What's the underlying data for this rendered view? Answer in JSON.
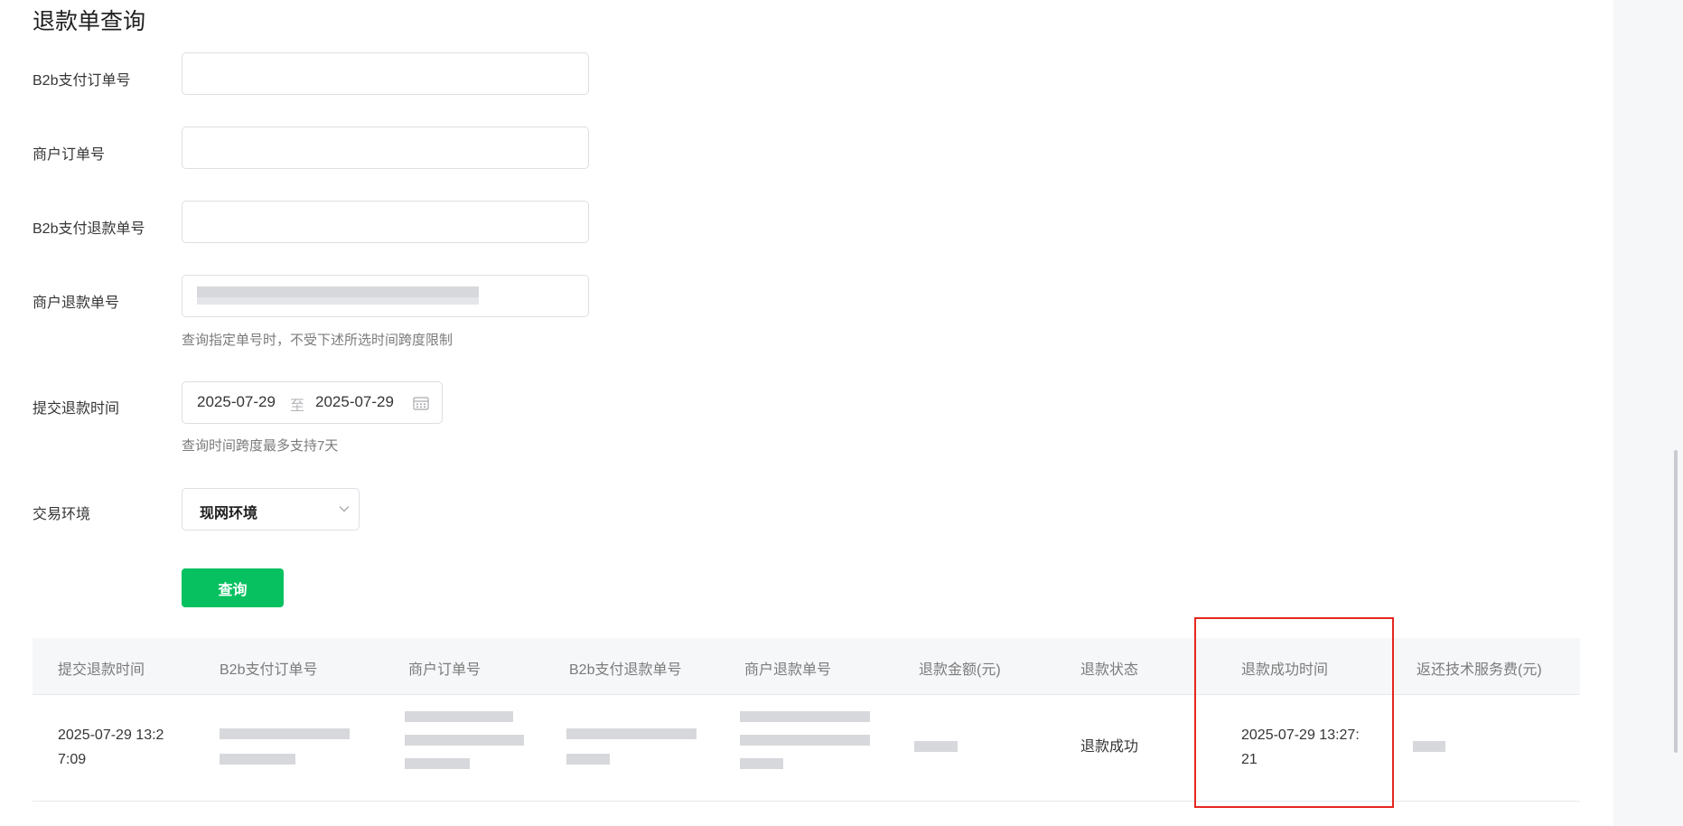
{
  "page": {
    "title": "退款单查询"
  },
  "form": {
    "b2b_order_label": "B2b支付订单号",
    "b2b_order_value": "",
    "merchant_order_label": "商户订单号",
    "merchant_order_value": "",
    "b2b_refund_label": "B2b支付退款单号",
    "b2b_refund_value": "",
    "merchant_refund_label": "商户退款单号",
    "merchant_refund_hint": "查询指定单号时，不受下述所选时间跨度限制",
    "refund_time_label": "提交退款时间",
    "date_start": "2025-07-29",
    "date_separator": "至",
    "date_end": "2025-07-29",
    "date_hint": "查询时间跨度最多支持7天",
    "env_label": "交易环境",
    "env_value": "现网环境",
    "query_button": "查询"
  },
  "table": {
    "columns": [
      "提交退款时间",
      "B2b支付订单号",
      "商户订单号",
      "B2b支付退款单号",
      "商户退款单号",
      "退款金额(元)",
      "退款状态",
      "退款成功时间",
      "返还技术服务费(元)"
    ],
    "rows": [
      {
        "submit_time_line1": "2025-07-29 13:2",
        "submit_time_line2": "7:09",
        "status": "退款成功",
        "success_time_line1": "2025-07-29 13:27:",
        "success_time_line2": "21"
      }
    ]
  },
  "colors": {
    "accent": "#07c160",
    "highlight": "#e5271f",
    "header_bg": "#f6f7f9"
  }
}
